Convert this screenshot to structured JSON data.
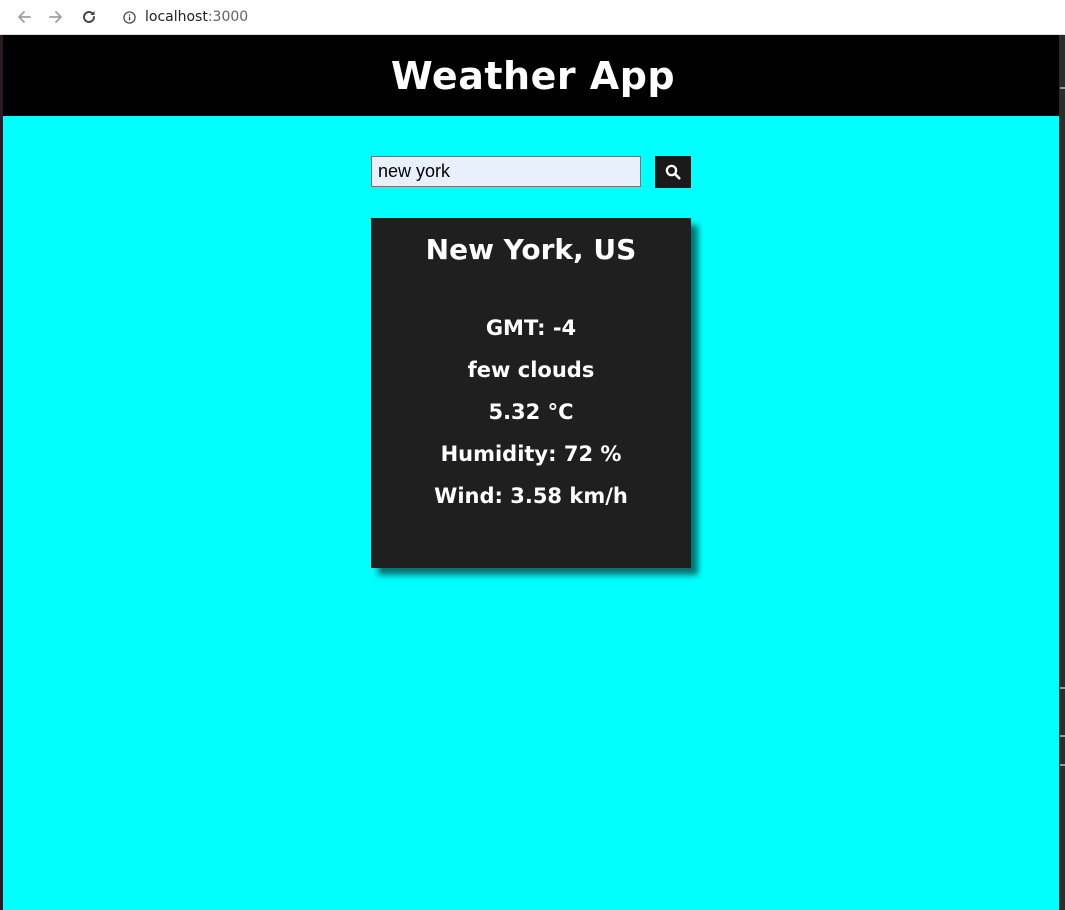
{
  "browser": {
    "url_host": "localhost",
    "url_port": ":3000",
    "back_icon": "arrow-left-icon",
    "forward_icon": "arrow-right-icon",
    "reload_icon": "reload-icon",
    "info_icon": "info-circle-icon"
  },
  "header": {
    "title": "Weather App",
    "background": "#000000"
  },
  "search": {
    "value": "new york",
    "icon": "search-icon"
  },
  "weather": {
    "city": "New York, US",
    "gmt": "GMT: -4",
    "description": "few clouds",
    "temperature": "5.32 °C",
    "humidity": "Humidity: 72 %",
    "wind": "Wind: 3.58 km/h"
  },
  "colors": {
    "page_background": "#00ffff",
    "card_background": "#1f1f1f",
    "input_background": "#e8f0fe"
  }
}
